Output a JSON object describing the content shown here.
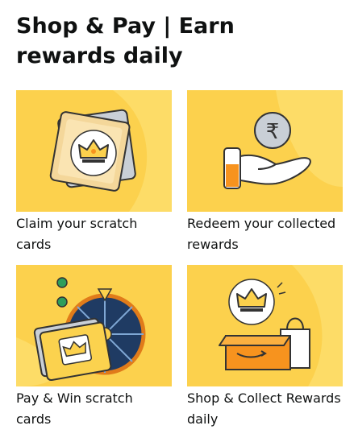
{
  "page": {
    "title": "Shop & Pay | Earn rewards daily"
  },
  "cards": [
    {
      "label": "Claim your scratch cards",
      "icon": "scratch-cards-crown-icon"
    },
    {
      "label": "Redeem your collected rewards",
      "icon": "hand-rupee-coin-icon"
    },
    {
      "label": "Pay & Win scratch cards",
      "icon": "spin-wheel-icon"
    },
    {
      "label": "Shop & Collect Rewards daily",
      "icon": "shopping-box-crown-icon"
    }
  ],
  "colors": {
    "tile_background": "#fcd14d",
    "accent_orange": "#f7931e",
    "text": "#0f1111"
  }
}
